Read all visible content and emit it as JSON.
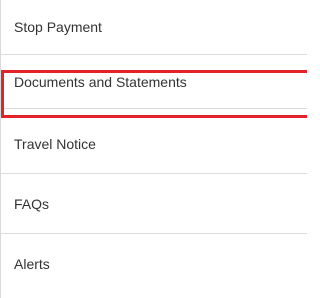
{
  "menu": {
    "items": [
      {
        "label": "Stop Payment"
      },
      {
        "label": "Documents and Statements",
        "highlighted": true
      },
      {
        "label": "Travel Notice"
      },
      {
        "label": "FAQs"
      },
      {
        "label": "Alerts"
      }
    ],
    "highlight_color": "#e2232a"
  }
}
